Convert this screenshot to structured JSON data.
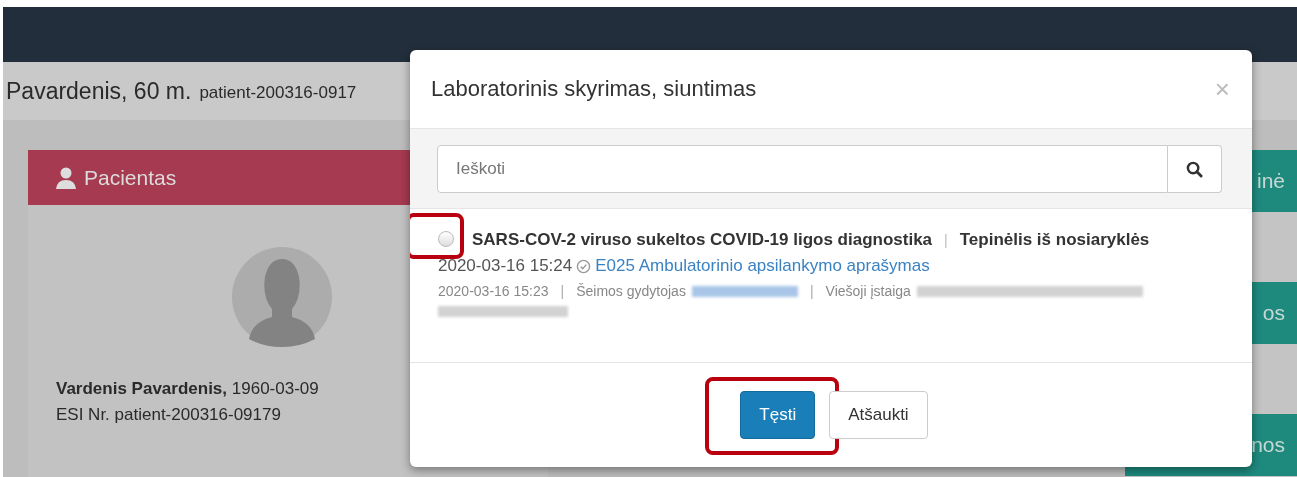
{
  "page": {
    "patient_heading": "Pavardenis, 60 m.",
    "patient_id": "patient-200316-0917",
    "card_title": "Pacientas",
    "patient_name": "**Vardenis Pavardenis,** 1960-03-09",
    "esi": "ESI Nr. patient-200316-09179",
    "side_buttons": [
      "inė",
      "os",
      "nos"
    ]
  },
  "modal": {
    "title": "Laboratorinis skyrimas, siuntimas",
    "close": "×",
    "search": {
      "placeholder": "Ieškoti"
    },
    "items": [
      {
        "selected": false,
        "highlighted": true,
        "title": "SARS-COV-2 viruso sukeltos COVID-19 ligos diagnostika",
        "separator": "|",
        "specimen": "Tepinėlis iš nosiaryklės",
        "date": "2020-03-16 15:24",
        "verified": true,
        "document_link": "E025 Ambulatorinio apsilankymo aprašymas",
        "meta_date": "2020-03-16 15:23",
        "meta_sep": "|",
        "doctor_label": "Šeimos gydytojas",
        "meta_sep2": "|",
        "institution_label": "Viešoji įstaiga"
      }
    ],
    "buttons": [
      {
        "label": "Tęsti",
        "kind": "primary",
        "highlighted": true
      },
      {
        "label": "Atšaukti",
        "kind": "default",
        "highlighted": false
      }
    ]
  }
}
